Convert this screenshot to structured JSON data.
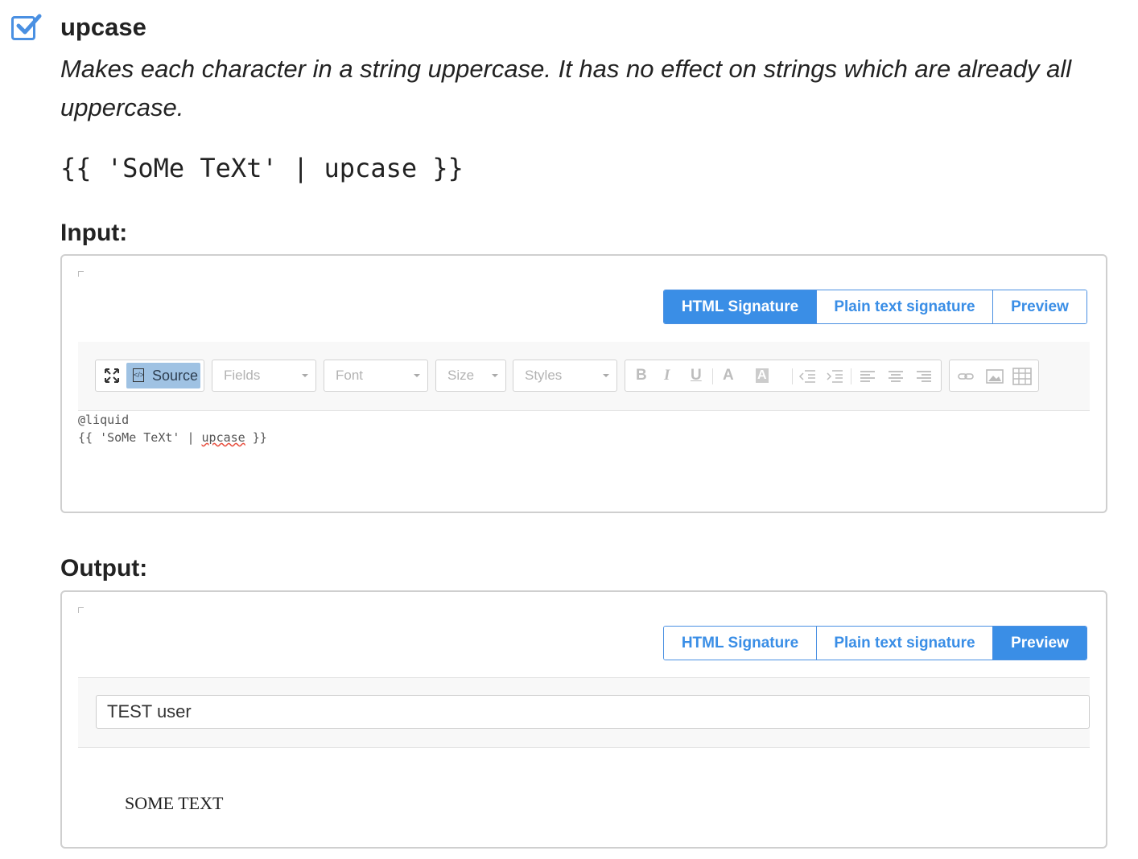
{
  "filter": {
    "name": "upcase",
    "description": "Makes each character in a string uppercase. It has no effect on strings which are already all uppercase.",
    "example": "{{ 'SoMe TeXt' | upcase }}",
    "accent_color": "#4a90e2"
  },
  "input_section": {
    "label": "Input:",
    "tabs": [
      "HTML Signature",
      "Plain text signature",
      "Preview"
    ],
    "active_tab": "HTML Signature",
    "toolbar": {
      "maximize_icon": "maximize-icon",
      "source_label": "Source",
      "fields_placeholder": "Fields",
      "font_placeholder": "Font",
      "size_placeholder": "Size",
      "styles_placeholder": "Styles",
      "bold": "B",
      "italic": "I",
      "underline": "U",
      "text_color": "A",
      "bg_color": "A"
    },
    "source_lines": [
      "@liquid",
      "{{ 'SoMe TeXt' | ",
      "upcase",
      " }}"
    ]
  },
  "output_section": {
    "label": "Output:",
    "tabs": [
      "HTML Signature",
      "Plain text signature",
      "Preview"
    ],
    "active_tab": "Preview",
    "preview_user": "TEST user",
    "result": "SOME TEXT"
  }
}
